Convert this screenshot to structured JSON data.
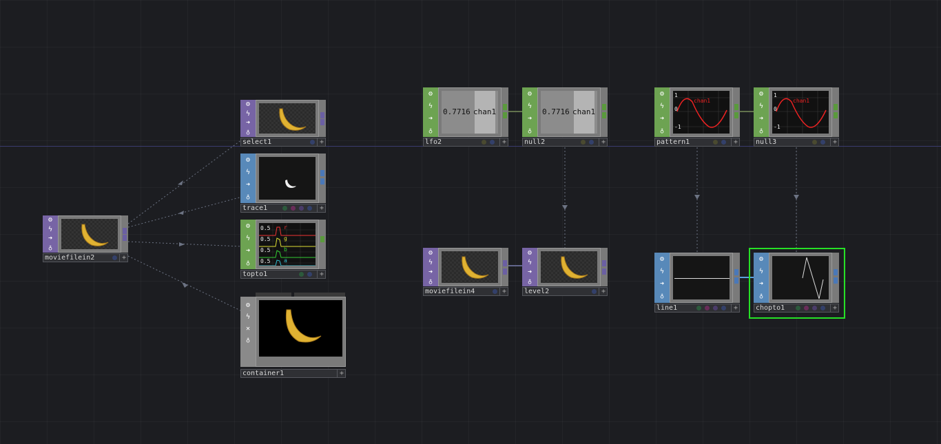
{
  "app": "TouchDesigner network editor",
  "colors": {
    "top_family": "#7764a5",
    "chop_family": "#6da352",
    "tex_family": "#5889b9",
    "comp_family": "#8a8a8a",
    "selection": "#26e126"
  },
  "nodes": {
    "moviefilein2": {
      "name": "moviefilein2",
      "family": "TOP",
      "viewer": "banana image"
    },
    "select1": {
      "name": "select1",
      "family": "TOP",
      "viewer": "banana image"
    },
    "trace1": {
      "name": "trace1",
      "family": "SOP",
      "viewer": "traced outline"
    },
    "topto1": {
      "name": "topto1",
      "family": "CHOP",
      "viewer": "rgba channels",
      "channel_values": [
        "0.5",
        "0.5",
        "0.5",
        "0.5"
      ],
      "channel_letters": [
        "r",
        "g",
        "b",
        "a"
      ]
    },
    "container1": {
      "name": "container1",
      "family": "COMP",
      "viewer": "banana image"
    },
    "lfo2": {
      "name": "lfo2",
      "family": "CHOP",
      "value": "0.7716",
      "channel": "chan1"
    },
    "null2": {
      "name": "null2",
      "family": "CHOP",
      "value": "0.7716",
      "channel": "chan1"
    },
    "pattern1": {
      "name": "pattern1",
      "family": "CHOP",
      "channel": "chan1",
      "axis_ticks": [
        "1",
        "0",
        "-1"
      ]
    },
    "null3": {
      "name": "null3",
      "family": "CHOP",
      "channel": "chan1",
      "axis_ticks": [
        "1",
        "0",
        "-1"
      ]
    },
    "moviefilein4": {
      "name": "moviefilein4",
      "family": "TOP",
      "viewer": "banana image"
    },
    "level2": {
      "name": "level2",
      "family": "TOP",
      "viewer": "banana image"
    },
    "line1": {
      "name": "line1",
      "family": "SOP",
      "viewer": "horizontal line"
    },
    "chopto1": {
      "name": "chopto1",
      "family": "SOP",
      "viewer": "zigzag line",
      "selected": true
    }
  },
  "icons": [
    "gear-icon",
    "lightning-icon",
    "arrow-right-icon",
    "lock-icon",
    "x-icon",
    "plus-icon"
  ]
}
